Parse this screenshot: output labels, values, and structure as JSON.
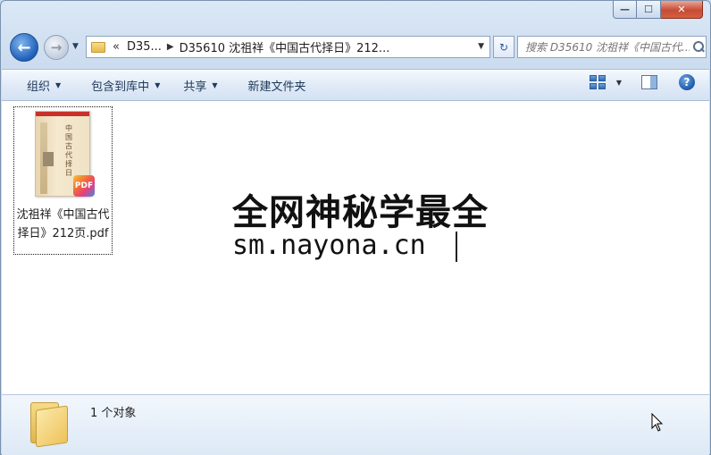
{
  "window": {
    "caption": {
      "minimize": "—",
      "maximize": "☐",
      "close": "✕"
    }
  },
  "nav": {
    "back_glyph": "←",
    "forward_glyph": "→",
    "address": {
      "overflow": "«",
      "crumb_parent": "D35...",
      "crumb_current": "D35610 沈祖祥《中国古代择日》212..."
    },
    "search_placeholder": "搜索 D35610 沈祖祥《中国古代..."
  },
  "toolbar": {
    "organize": "组织",
    "include_in_library": "包含到库中",
    "share": "共享",
    "new_folder": "新建文件夹"
  },
  "files": [
    {
      "name": "沈祖祥《中国古代择日》212页.pdf",
      "thumb_text": "中国古代择日",
      "badge": "PDF"
    }
  ],
  "watermark": {
    "line1": "全网神秘学最全",
    "line2": "sm.nayona.cn"
  },
  "details": {
    "count_text": "1 个对象"
  },
  "icons": {
    "help": "?",
    "refresh": "↻"
  }
}
